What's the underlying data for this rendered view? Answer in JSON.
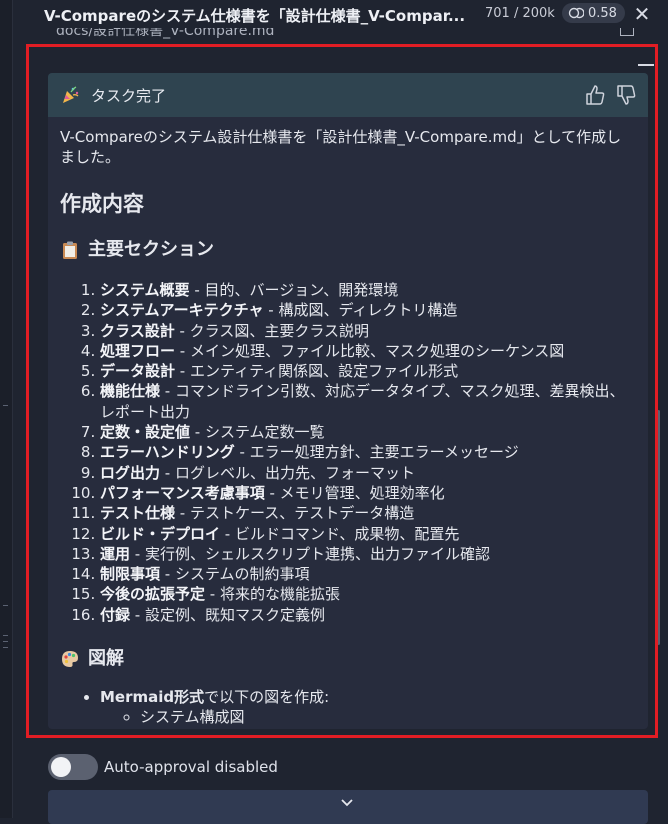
{
  "header": {
    "title": "V-Compareのシステム仕様書を「設計仕様書_V-Compar...",
    "tokens": "701 / 200k",
    "cost": "0.58"
  },
  "behind": {
    "path": "docs/設計仕様書_V-Compare.md"
  },
  "card": {
    "status": "タスク完了",
    "intro": "V-Compareのシステム設計仕様書を「設計仕様書_V-Compare.md」として作成しました。",
    "heading": "作成内容",
    "sections_heading": "主要セクション",
    "sections": [
      {
        "name": "システム概要",
        "desc": " - 目的、バージョン、開発環境"
      },
      {
        "name": "システムアーキテクチャ",
        "desc": " - 構成図、ディレクトリ構造"
      },
      {
        "name": "クラス設計",
        "desc": " - クラス図、主要クラス説明"
      },
      {
        "name": "処理フロー",
        "desc": " - メイン処理、ファイル比較、マスク処理のシーケンス図"
      },
      {
        "name": "データ設計",
        "desc": " - エンティティ関係図、設定ファイル形式"
      },
      {
        "name": "機能仕様",
        "desc": " - コマンドライン引数、対応データタイプ、マスク処理、差異検出、レポート出力"
      },
      {
        "name": "定数・設定値",
        "desc": " - システム定数一覧"
      },
      {
        "name": "エラーハンドリング",
        "desc": " - エラー処理方針、主要エラーメッセージ"
      },
      {
        "name": "ログ出力",
        "desc": " - ログレベル、出力先、フォーマット"
      },
      {
        "name": "パフォーマンス考慮事項",
        "desc": " - メモリ管理、処理効率化"
      },
      {
        "name": "テスト仕様",
        "desc": " - テストケース、テストデータ構造"
      },
      {
        "name": "ビルド・デプロイ",
        "desc": " - ビルドコマンド、成果物、配置先"
      },
      {
        "name": "運用",
        "desc": " - 実行例、シェルスクリプト連携、出力ファイル確認"
      },
      {
        "name": "制限事項",
        "desc": " - システムの制約事項"
      },
      {
        "name": "今後の拡張予定",
        "desc": " - 将来的な機能拡張"
      },
      {
        "name": "付録",
        "desc": " - 設定例、既知マスク定義例"
      }
    ],
    "diagrams_heading": "図解",
    "diagrams_item_bold": "Mermaid形式",
    "diagrams_item_rest": "で以下の図を作成:",
    "diagrams_sub": [
      "システム構成図"
    ]
  },
  "footer": {
    "auto_approval": "Auto-approval disabled"
  },
  "colors": {
    "frame": "#e11d24",
    "card_header": "#2f4450",
    "card_bg": "#272c3d"
  },
  "icons": [
    "party-popper-icon",
    "thumbs-up-icon",
    "thumbs-down-icon",
    "clipboard-icon",
    "palette-icon",
    "close-icon",
    "chevron-down-icon",
    "coins-icon"
  ]
}
